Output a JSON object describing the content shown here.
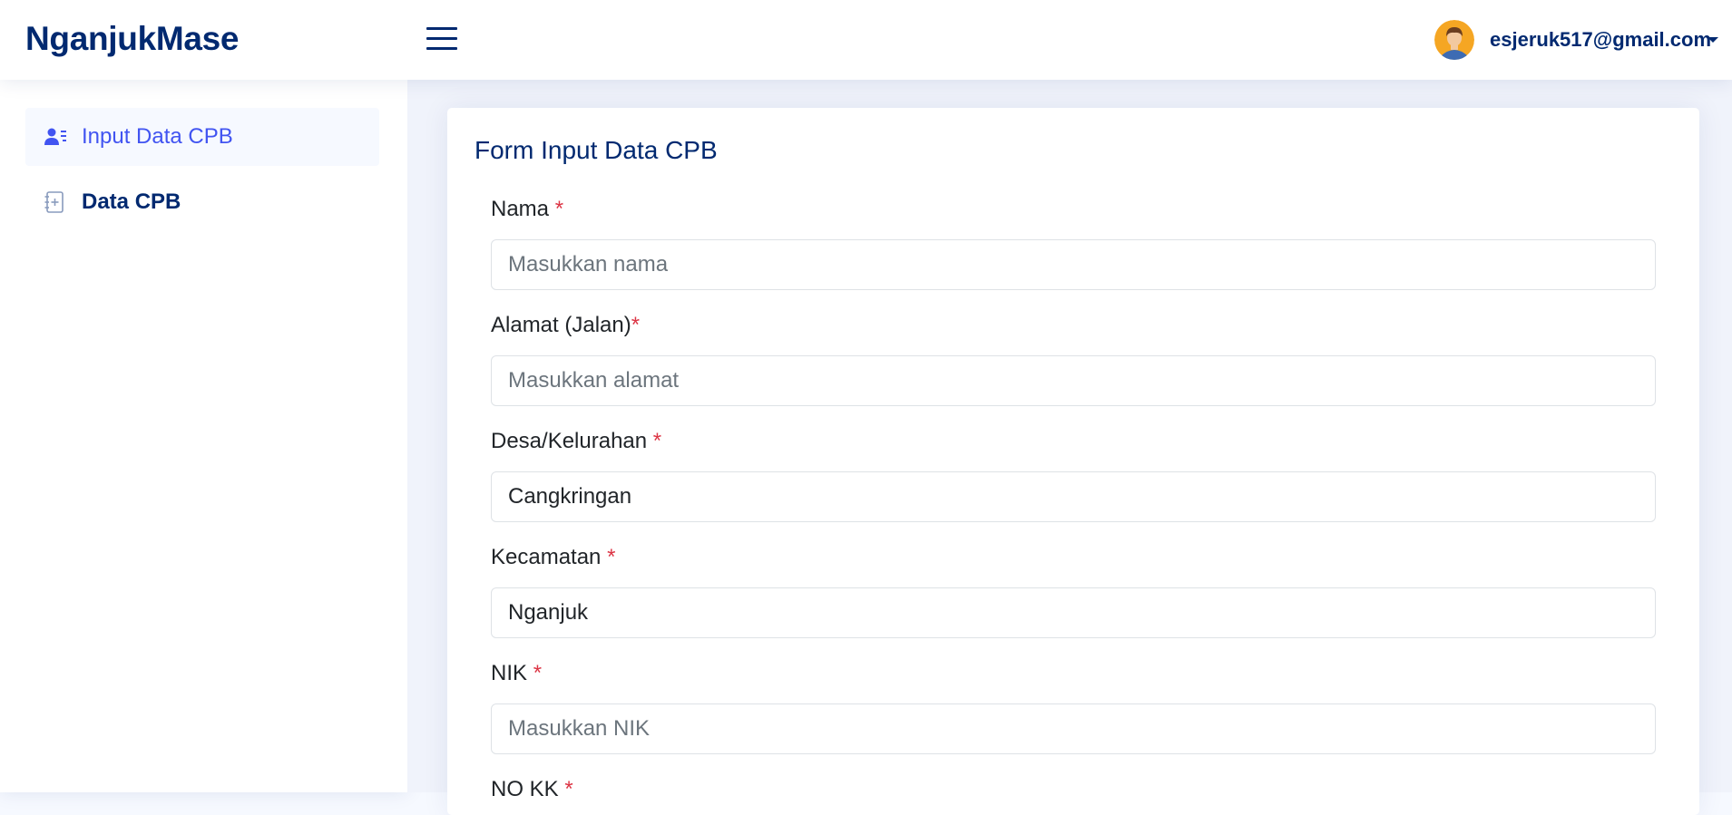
{
  "header": {
    "logo": "NganjukMase",
    "user_email": "esjeruk517@gmail.com"
  },
  "sidebar": {
    "items": [
      {
        "label": "Input Data CPB",
        "icon": "person-lines-icon",
        "active": true
      },
      {
        "label": "Data CPB",
        "icon": "journal-plus-icon",
        "active": false
      }
    ]
  },
  "form": {
    "title": "Form Input Data CPB",
    "fields": [
      {
        "label": "Nama ",
        "required_mark": "*",
        "value": "",
        "placeholder": "Masukkan nama"
      },
      {
        "label": "Alamat (Jalan)",
        "required_mark": "*",
        "value": "",
        "placeholder": "Masukkan alamat"
      },
      {
        "label": "Desa/Kelurahan ",
        "required_mark": "*",
        "value": "Cangkringan",
        "placeholder": ""
      },
      {
        "label": "Kecamatan ",
        "required_mark": "*",
        "value": "Nganjuk",
        "placeholder": ""
      },
      {
        "label": "NIK ",
        "required_mark": "*",
        "value": "",
        "placeholder": "Masukkan NIK"
      },
      {
        "label": "NO KK ",
        "required_mark": "*"
      }
    ]
  },
  "colors": {
    "brand": "#012970",
    "accent": "#4154f1",
    "required": "#dc3545",
    "avatar_bg": "#f5a623"
  }
}
